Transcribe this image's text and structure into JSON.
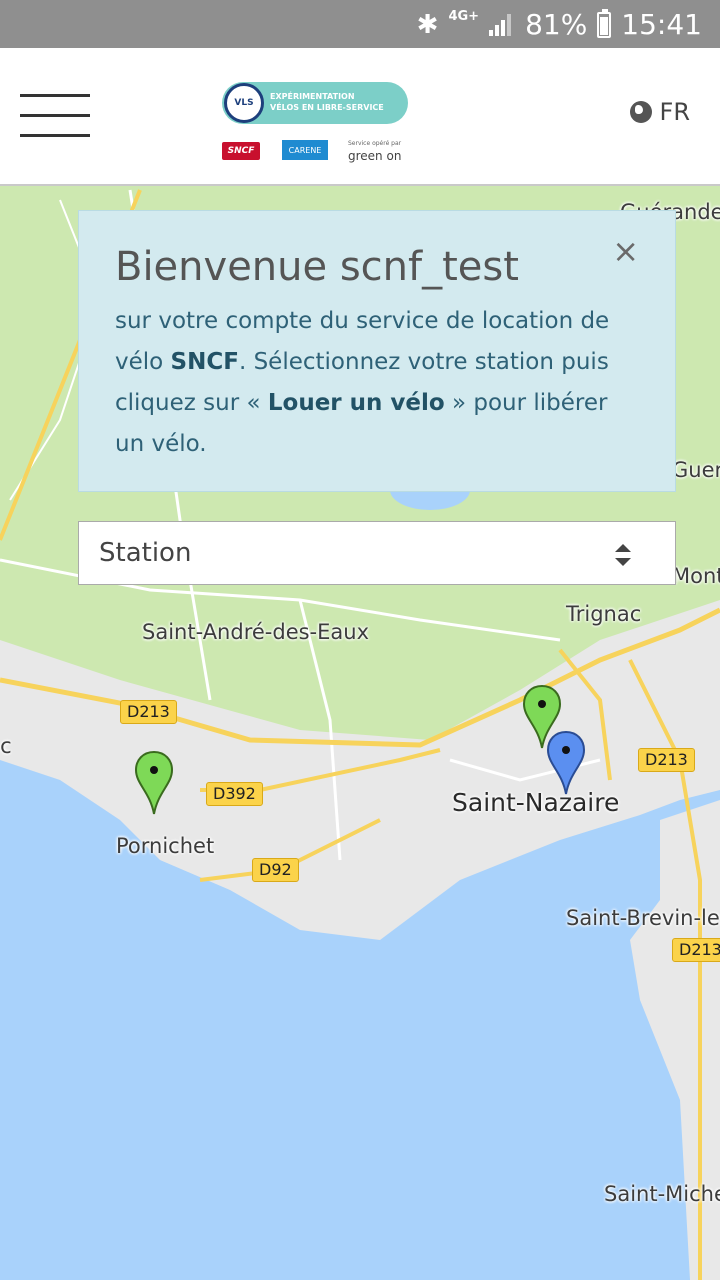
{
  "status_bar": {
    "network": "4G+",
    "battery": "81%",
    "battery_level": 0.81,
    "time": "15:41"
  },
  "header": {
    "logo": {
      "vls_badge": "VLS",
      "title_line1": "EXPÉRIMENTATION",
      "title_line2": "VÉLOS EN LIBRE-SERVICE",
      "partner1": "SNCF",
      "partner2": "CARENE",
      "partner3_small": "Service opéré par",
      "partner3": "green on"
    },
    "language": "FR"
  },
  "welcome": {
    "title": "Bienvenue scnf_test",
    "text1": "sur votre compte du service de location de vélo ",
    "brand": "SNCF",
    "text2": ". Sélectionnez votre station puis cliquez sur « ",
    "action": "Louer un vélo",
    "text3": " » pour libérer un vélo.",
    "close": "×"
  },
  "station_select": {
    "value": "Station"
  },
  "map": {
    "places": {
      "guerande_top": "Guérande",
      "escoublac": "La Baule-Escoublac",
      "saint_andre": "Saint-André-des-Eaux",
      "trignac": "Trignac",
      "saint_nazaire": "Saint-Nazaire",
      "pornichet": "Pornichet",
      "saint_brevin": "Saint-Brevin-les-Pins",
      "saint_michel": "Saint-Michel",
      "gue_right": "Guer",
      "montoir": "Montoir-de-Bretagne"
    },
    "roads": {
      "d213_left": "D213",
      "d392": "D392",
      "d92": "D92",
      "d213_right": "D213",
      "d213_far_right": "D213"
    },
    "markers": [
      {
        "name": "station-pornichet",
        "color": "#7ed957",
        "status": "available"
      },
      {
        "name": "station-saint-nazaire",
        "color": "#7ed957",
        "status": "available"
      },
      {
        "name": "user-location",
        "color": "#5b8ff0",
        "status": "selected"
      }
    ],
    "colors": {
      "land": "#e8e8e8",
      "green": "#cde8b0",
      "water": "#a9d2fb",
      "road_yellow": "#f7d35c"
    }
  }
}
